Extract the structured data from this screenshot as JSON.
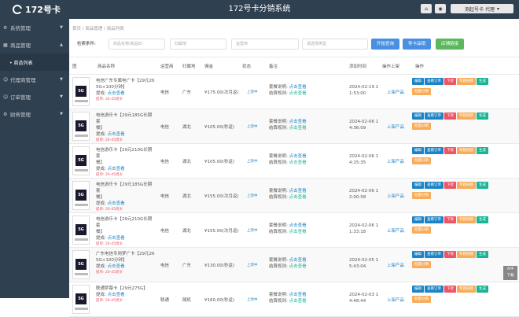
{
  "header": {
    "logo_text": "172号卡",
    "title": "172号卡分销系统",
    "user_label": "测起号卡 代理",
    "home_icon": "home-icon",
    "eye_icon": "eye-icon"
  },
  "sidebar": {
    "items": [
      {
        "label": "系统管理",
        "icon": "gear-icon",
        "expanded": false
      },
      {
        "label": "商品管理",
        "icon": "cart-icon",
        "expanded": true
      },
      {
        "label": "代理商管理",
        "icon": "user-icon",
        "expanded": false
      },
      {
        "label": "订单管理",
        "icon": "user-icon",
        "expanded": false
      },
      {
        "label": "财务管理",
        "icon": "gear-icon",
        "expanded": false
      }
    ],
    "sub_item": "• 商品列表"
  },
  "breadcrumb": "首页 / 商品管理 / 商品列表",
  "search": {
    "label": "检索条件:",
    "name_placeholder": "商品名称/商品ID",
    "city_placeholder": "归属地",
    "operator_placeholder": "运营商",
    "type_placeholder": "请选择类型",
    "btn_search": "开始查询",
    "btn_upload": "导卡品销",
    "btn_link": "店铺链接"
  },
  "table": {
    "headers": [
      "图",
      "商品名称",
      "运营商",
      "归属地",
      "佣金",
      "状态",
      "备注",
      "添加时间",
      "操作上架",
      "操作"
    ],
    "rows": [
      {
        "name": "电信广东专属电广卡【29元26\n5G+100分钟】",
        "sale_info": "提单: 20-45周岁",
        "area": "广东",
        "operator": "电信",
        "commission": "¥175.00(次月返)",
        "status": "上架中",
        "note1": "套餐说明:",
        "note2": "结算规则:",
        "note_link1": "点击查看",
        "note_link2": "点击查看",
        "time": "2024-02-19 1\n1:53:00",
        "ops_label": "上架产品",
        "thumb_text": "5G"
      },
      {
        "name": "电信游乐卡【29元185G长期套\n餐】",
        "sale_info": "提单: 20-45周岁",
        "area": "湖北",
        "operator": "电信",
        "commission": "¥105.00(秒返)",
        "status": "上架中",
        "note1": "套餐说明:",
        "note2": "结算规则:",
        "note_link1": "点击查看",
        "note_link2": "点击查看",
        "time": "2024-02-06 1\n4:36:09",
        "ops_label": "上架产品",
        "thumb_text": "5G"
      },
      {
        "name": "电信游乐卡【29元210G长期套\n餐】",
        "sale_info": "提单: 20-45周岁",
        "area": "湖北",
        "operator": "电信",
        "commission": "¥105.00(秒返)",
        "status": "上架中",
        "note1": "套餐说明:",
        "note2": "结算规则:",
        "note_link1": "点击查看",
        "note_link2": "点击查看",
        "time": "2024-02-06 1\n4:25:35",
        "ops_label": "上架产品",
        "thumb_text": "5G"
      },
      {
        "name": "电信游乐卡【29元185G长期套\n餐】",
        "sale_info": "提单: 20-45周岁",
        "area": "湖北",
        "operator": "电信",
        "commission": "¥155.00(次月返)",
        "status": "上架中",
        "note1": "套餐说明:",
        "note2": "结算规则:",
        "note_link1": "点击查看",
        "note_link2": "点击查看",
        "time": "2024-02-06 1\n2:00:58",
        "ops_label": "上架产品",
        "thumb_text": "5G"
      },
      {
        "name": "电信游乐卡【29元210G长期套\n餐】",
        "sale_info": "提单: 20-45周岁",
        "area": "湖北",
        "operator": "电信",
        "commission": "¥155.00(次月返)",
        "status": "上架中",
        "note1": "套餐说明:",
        "note2": "结算规则:",
        "note_link1": "点击查看",
        "note_link2": "点击查看",
        "time": "2024-02-06 1\n1:33:18",
        "ops_label": "上架产品",
        "thumb_text": "5G"
      },
      {
        "name": "广东电信专用梦广卡【29元26\n5G+100分钟】",
        "sale_info": "提单: 20-45周岁",
        "area": "广东",
        "operator": "电信",
        "commission": "¥130.00(秒返)",
        "status": "上架中",
        "note1": "套餐说明:",
        "note2": "结算规则:",
        "note_link1": "点击查看",
        "note_link2": "点击查看",
        "time": "2024-02-05 1\n5:43:04",
        "ops_label": "上架产品",
        "thumb_text": "5G"
      },
      {
        "name": "联通梦幕卡【29元275G】",
        "sale_info": "提单: 20-45周岁",
        "area": "随机",
        "operator": "联通",
        "commission": "¥160.00(秒返)",
        "status": "上架中",
        "note1": "套餐说明:",
        "note2": "结算规则:",
        "note_link1": "点击查看",
        "note_link2": "点击查看",
        "time": "2024-02-03 1\n4:48:44",
        "ops_label": "上架产品",
        "thumb_text": "5G"
      }
    ],
    "row_ops": [
      "编辑",
      "查看订单",
      "下架",
      "专题链接",
      "生成",
      "批量分销"
    ]
  },
  "app_download": "APP\n下载",
  "colors": {
    "sidebar_bg": "#2f4050",
    "link": "#1c84c6",
    "red": "#ed5565",
    "orange": "#f8ac59",
    "green": "#1ab394"
  }
}
